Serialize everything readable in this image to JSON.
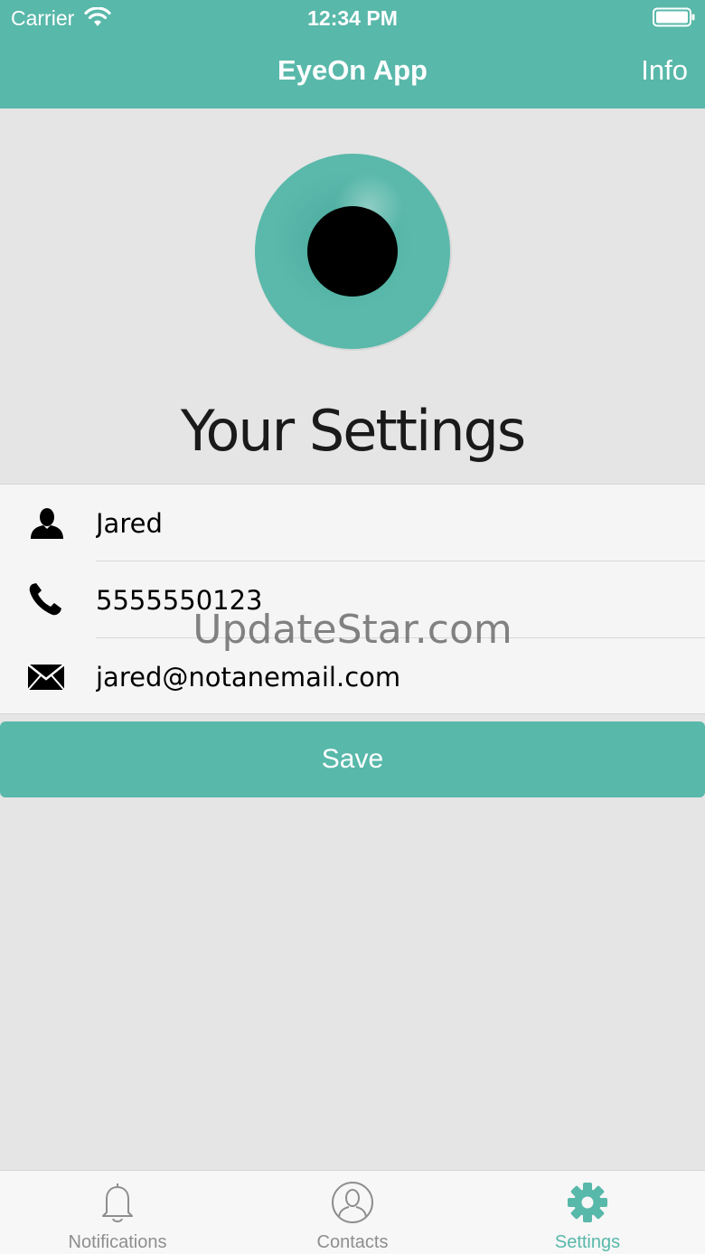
{
  "status_bar": {
    "carrier": "Carrier",
    "time": "12:34 PM"
  },
  "nav": {
    "title": "EyeOn App",
    "right_button": "Info"
  },
  "logo": {
    "icon": "eye-logo-icon"
  },
  "page_title": "Your Settings",
  "form": {
    "name": {
      "icon": "person-icon",
      "value": "Jared"
    },
    "phone": {
      "icon": "phone-icon",
      "value": "5555550123"
    },
    "email": {
      "icon": "envelope-icon",
      "value": "jared@notanemail.com"
    }
  },
  "watermark": "UpdateStar.com",
  "save_button": "Save",
  "tabs": [
    {
      "label": "Notifications",
      "icon": "bell-icon",
      "active": false
    },
    {
      "label": "Contacts",
      "icon": "contact-icon",
      "active": false
    },
    {
      "label": "Settings",
      "icon": "gear-icon",
      "active": true
    }
  ],
  "colors": {
    "accent": "#58b8aa",
    "background": "#e5e5e5",
    "inactive_tab": "#8e8e8e"
  }
}
